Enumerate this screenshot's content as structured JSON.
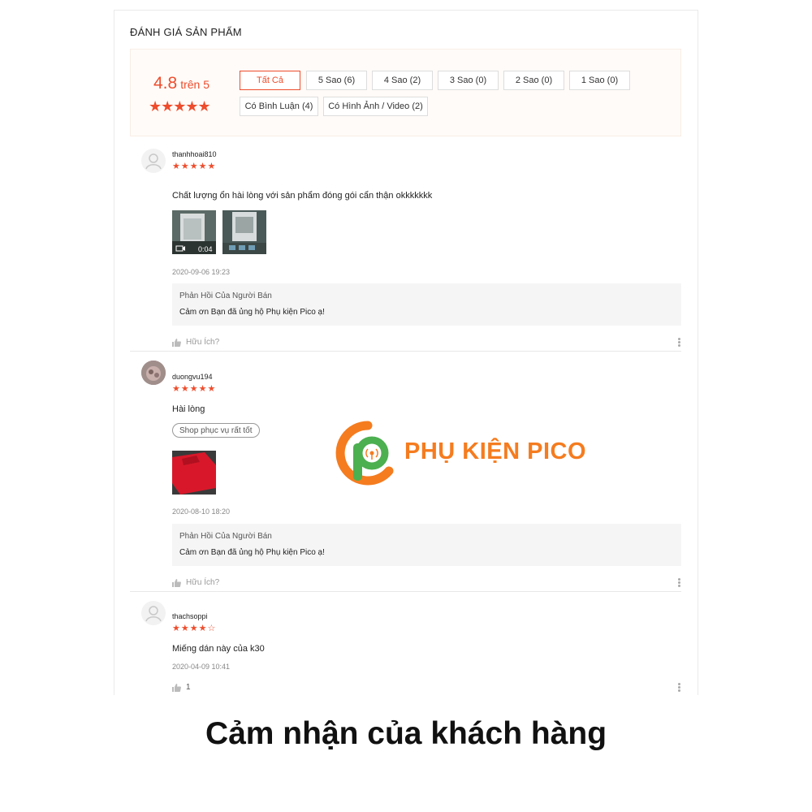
{
  "section_title": "ĐÁNH GIÁ SẢN PHẨM",
  "overview": {
    "score": "4.8",
    "score_suffix": "trên 5",
    "rating_stars": 5,
    "filters_row1": [
      "Tất Cả",
      "5 Sao (6)",
      "4 Sao (2)",
      "3 Sao (0)",
      "2 Sao (0)",
      "1 Sao (0)"
    ],
    "filters_row2": [
      "Có Bình Luận (4)",
      "Có Hình Ảnh / Video (2)"
    ],
    "active_filter": "Tất Cả"
  },
  "reviews": [
    {
      "username": "thanhhoai810",
      "stars": 5,
      "comment": "Chất lượng ổn hài lòng với sản phẩm đóng gói cẩn thận okkkkkkk",
      "video_duration": "0:04",
      "time": "2020-09-06 19:23",
      "reply_title": "Phản Hồi Của Người Bán",
      "reply_body": "Cảm ơn Bạn đã ủng hộ Phụ kiện Pico ạ!",
      "helpful": "Hữu Ích?"
    },
    {
      "username": "duongvu194",
      "stars": 5,
      "comment": "Hài lòng",
      "tag": "Shop phục vụ rất tốt",
      "time": "2020-08-10 18:20",
      "reply_title": "Phản Hồi Của Người Bán",
      "reply_body": "Cảm ơn Bạn đã ủng hộ Phụ kiện Pico ạ!",
      "helpful": "Hữu Ích?"
    },
    {
      "username": "thachsoppi",
      "stars": 4,
      "comment": "Miếng dán này của k30",
      "time": "2020-04-09 10:41",
      "helpful": "1"
    }
  ],
  "watermark_logo": "PHỤ KIỆN PICO",
  "caption": "Cảm nhận của khách hàng",
  "colors": {
    "accent": "#ee4d2d",
    "logo_orange": "#f57c1f",
    "logo_green": "#4caf50"
  }
}
